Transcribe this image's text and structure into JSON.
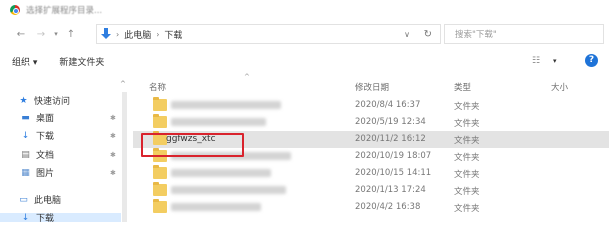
{
  "window": {
    "title": "选择扩展程序目录..."
  },
  "address": {
    "back": "←",
    "forward": "→",
    "recent": "▾",
    "up": "↑",
    "crumbs": [
      "此电脑",
      "下载"
    ],
    "separator": "›",
    "dropdown": "∨",
    "refresh": "↻",
    "search_placeholder": "搜索\"下载\""
  },
  "toolbar": {
    "organize": "组织 ▾",
    "new_folder": "新建文件夹",
    "view": "☷",
    "view_drop": "▾",
    "help": "?"
  },
  "sidebar": {
    "scroll_up": "^",
    "items": [
      {
        "label": "快速访问",
        "icon": "★",
        "pinned": false
      },
      {
        "label": "桌面",
        "icon": "▬",
        "pinned": true
      },
      {
        "label": "下载",
        "icon": "↓",
        "pinned": true
      },
      {
        "label": "文档",
        "icon": "▤",
        "pinned": true
      },
      {
        "label": "图片",
        "icon": "▦",
        "pinned": true
      },
      {
        "label": "此电脑",
        "icon": "▭",
        "pinned": false
      },
      {
        "label": "下载",
        "icon": "↓",
        "pinned": false
      }
    ],
    "pin_glyph": "✱"
  },
  "columns": {
    "name": "名称",
    "date": "修改日期",
    "type": "类型",
    "size": "大小",
    "sort_caret": "^"
  },
  "files": [
    {
      "name": "",
      "date": "2020/8/4 16:37",
      "type": "文件夹",
      "blur_width": 110
    },
    {
      "name": "",
      "date": "2020/5/19 12:34",
      "type": "文件夹",
      "blur_width": 95
    },
    {
      "name": "ggfwzs_xtc",
      "date": "2020/11/2 16:12",
      "type": "文件夹",
      "selected": true
    },
    {
      "name": "",
      "date": "2020/10/19 18:07",
      "type": "文件夹",
      "blur_width": 120
    },
    {
      "name": "",
      "date": "2020/10/15 14:11",
      "type": "文件夹",
      "blur_width": 100
    },
    {
      "name": "",
      "date": "2020/1/13 17:24",
      "type": "文件夹",
      "blur_width": 115
    },
    {
      "name": "",
      "date": "2020/4/2 16:38",
      "type": "文件夹",
      "blur_width": 90
    }
  ],
  "colors": {
    "highlight_border": "#d9232d",
    "selected_row": "#e3e3e3",
    "folder": "#f3cd61",
    "accent": "#1e73d8"
  }
}
